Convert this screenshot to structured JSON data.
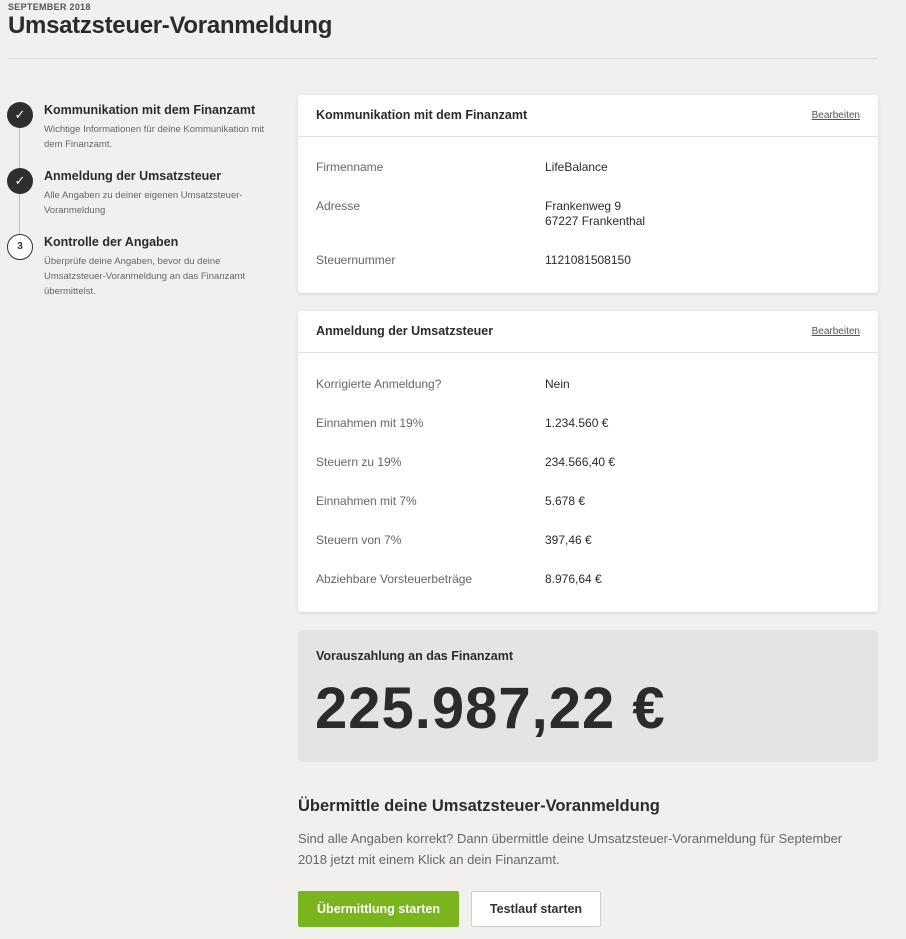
{
  "header": {
    "eyebrow": "SEPTEMBER 2018",
    "title": "Umsatzsteuer-Voranmeldung"
  },
  "stepper": {
    "steps": [
      {
        "status": "done",
        "icon": "check-icon",
        "marker": "✓",
        "title": "Kommunikation mit dem Finanzamt",
        "description": "Wichtige Informationen für deine Kommunikation mit dem Finanzamt."
      },
      {
        "status": "done",
        "icon": "check-icon",
        "marker": "✓",
        "title": "Anmeldung der Umsatzsteuer",
        "description": "Alle Angaben zu deiner eigenen Umsatzsteuer-Voranmeldung"
      },
      {
        "status": "current",
        "marker": "3",
        "title": "Kontrolle der Angaben",
        "description": "Überprüfe deine Angaben, bevor du deine Umsatzsteuer-Voranmeldung an das Finanzamt übermittelst."
      }
    ]
  },
  "communication_card": {
    "title": "Kommunikation mit dem Finanzamt",
    "edit_label": "Bearbeiten",
    "rows": [
      {
        "label": "Firmenname",
        "value": "LifeBalance"
      },
      {
        "label": "Adresse",
        "value_line1": "Frankenweg 9",
        "value_line2": "67227 Frankenthal"
      },
      {
        "label": "Steuernummer",
        "value": "1121081508150"
      }
    ]
  },
  "registration_card": {
    "title": "Anmeldung der Umsatzsteuer",
    "edit_label": "Bearbeiten",
    "rows": [
      {
        "label": "Korrigierte Anmeldung?",
        "value": "Nein"
      },
      {
        "label": "Einnahmen mit 19%",
        "value": "1.234.560 €"
      },
      {
        "label": "Steuern zu 19%",
        "value": "234.566,40 €"
      },
      {
        "label": "Einnahmen mit 7%",
        "value": "5.678 €"
      },
      {
        "label": "Steuern von 7%",
        "value": "397,46 €"
      },
      {
        "label": "Abziehbare Vorsteuerbeträge",
        "value": "8.976,64 €"
      }
    ]
  },
  "total": {
    "label": "Vorauszahlung an das Finanzamt",
    "amount": "225.987,22 €"
  },
  "submit": {
    "title": "Übermittle deine Umsatzsteuer-Voranmeldung",
    "text": "Sind alle Angaben korrekt? Dann übermittle deine Umsatzsteuer-Voranmeldung für September 2018 jetzt mit einem Klick an dein Finanzamt.",
    "primary_label": "Übermittlung starten",
    "secondary_label": "Testlauf starten"
  },
  "colors": {
    "background": "#f1f0ee",
    "primary_button": "#7ab51d",
    "step_done": "#2f2f2f",
    "total_box": "#e5e4e2"
  }
}
